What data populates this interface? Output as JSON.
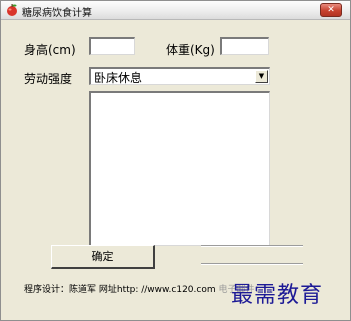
{
  "window": {
    "title": "糖尿病饮食计算",
    "close_label": "✕"
  },
  "form": {
    "height_label": "身高(cm)",
    "height_value": "",
    "weight_label": "体重(Kg)",
    "weight_value": "",
    "activity_label": "劳动强度",
    "activity_selected": "卧床休息"
  },
  "buttons": {
    "ok_label": "确定"
  },
  "footer": {
    "credit": "程序设计：陈道军  网址http: //www.c120.com",
    "faint_suffix": " 电子邮件：..."
  },
  "watermark": "最需教育",
  "colors": {
    "window_bg": "#ece9d8",
    "close_button": "#c7422f",
    "watermark": "#1d1a96"
  },
  "icons": {
    "app": "apple-icon",
    "close": "close-icon",
    "dropdown": "chevron-down-icon"
  }
}
